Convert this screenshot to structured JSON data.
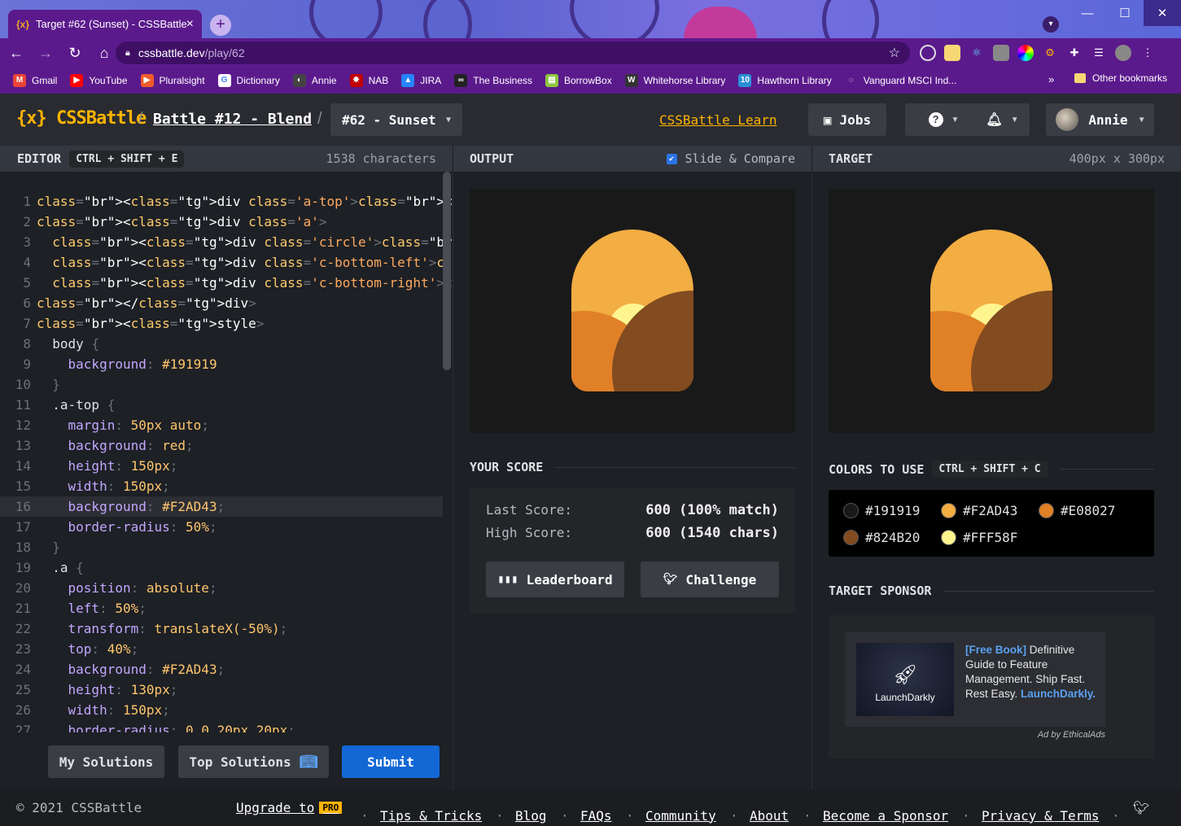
{
  "browser": {
    "tab_title": "Target #62 (Sunset) - CSSBattle",
    "tab_favicon": "{x}",
    "url_host": "cssbattle.dev",
    "url_path": "/play/62",
    "bookmarks": [
      {
        "label": "Gmail",
        "icon": "gmail-icon",
        "color": "#ea4335",
        "glyph": "M"
      },
      {
        "label": "YouTube",
        "icon": "youtube-icon",
        "color": "#ff0000",
        "glyph": "▶"
      },
      {
        "label": "Pluralsight",
        "icon": "pluralsight-icon",
        "color": "#f15b2a",
        "glyph": "▶"
      },
      {
        "label": "Dictionary",
        "icon": "google-icon",
        "color": "#ffffff",
        "glyph": "G"
      },
      {
        "label": "Annie",
        "icon": "annie-icon",
        "color": "#444444",
        "glyph": "◐"
      },
      {
        "label": "NAB",
        "icon": "nab-star-icon",
        "color": "#c20000",
        "glyph": "✸"
      },
      {
        "label": "JIRA",
        "icon": "jira-icon",
        "color": "#2684ff",
        "glyph": "▲"
      },
      {
        "label": "The Business",
        "icon": "business-icon",
        "color": "#222222",
        "glyph": "∞"
      },
      {
        "label": "BorrowBox",
        "icon": "borrowbox-icon",
        "color": "#8dc63f",
        "glyph": "▤"
      },
      {
        "label": "Whitehorse Library",
        "icon": "whitehorse-icon",
        "color": "#333333",
        "glyph": "W"
      },
      {
        "label": "Hawthorn Library",
        "icon": "hawthorn-icon",
        "color": "#2b8fd6",
        "glyph": "10"
      },
      {
        "label": "Vanguard MSCI Ind...",
        "icon": "vanguard-icon",
        "color": "#5b1a8c",
        "glyph": "◌"
      }
    ],
    "bookmarks_more": "»",
    "other_bookmarks": "Other bookmarks"
  },
  "header": {
    "logo": "{x} CSSBattle",
    "battle": "Battle #12 - Blend",
    "target": "#62 - Sunset",
    "learn": "CSSBattle Learn",
    "jobs": "Jobs",
    "user": "Annie"
  },
  "editor": {
    "title": "EDITOR",
    "shortcut": "CTRL + SHIFT + E",
    "chars": "1538 characters",
    "my_solutions": "My Solutions",
    "top_solutions": "Top Solutions",
    "submit": "Submit"
  },
  "output": {
    "title": "OUTPUT",
    "slide_compare": "Slide & Compare"
  },
  "target": {
    "title": "TARGET",
    "size": "400px x 300px"
  },
  "score": {
    "title": "YOUR SCORE",
    "last_label": "Last Score:",
    "last_value": "600 (100% match)",
    "high_label": "High Score:",
    "high_value": "600 (1540 chars)",
    "leaderboard": "Leaderboard",
    "challenge": "Challenge"
  },
  "colors": {
    "title": "COLORS TO USE",
    "shortcut": "CTRL + SHIFT + C",
    "items": [
      "#191919",
      "#F2AD43",
      "#E08027",
      "#824B20",
      "#FFF58F"
    ]
  },
  "sponsor": {
    "title": "TARGET SPONSOR",
    "brand": "LaunchDarkly",
    "text_link": "[Free Book]",
    "text_body": " Definitive Guide to Feature Management. Ship Fast. Rest Easy. ",
    "text_brand": "LaunchDarkly.",
    "by": "Ad by EthicalAds"
  },
  "footer": {
    "copyright": "© 2021 CSSBattle",
    "upgrade": "Upgrade to",
    "pro": "PRO",
    "links": [
      "Tips & Tricks",
      "Blog",
      "FAQs",
      "Community",
      "About",
      "Become a Sponsor",
      "Privacy & Terms"
    ],
    "sep": "·"
  },
  "code": [
    "<div class='a-top'></div>",
    "<div class='a'>",
    "  <div class='circle'></div>",
    "  <div class='c-bottom-left'></div>",
    "  <div class='c-bottom-right'></div>",
    "</div>",
    "<style>",
    "  body {",
    "    background: #191919",
    "  }",
    "  .a-top {",
    "    margin: 50px auto;",
    "    background: red;",
    "    height: 150px;",
    "    width: 150px;",
    "    background: #F2AD43;",
    "    border-radius: 50%;",
    "  }",
    "  .a {",
    "    position: absolute;",
    "    left: 50%;",
    "    transform: translateX(-50%);",
    "    top: 40%;",
    "    background: #F2AD43;",
    "    height: 130px;",
    "    width: 150px;",
    "    border-radius: 0 0 20px 20px;"
  ]
}
